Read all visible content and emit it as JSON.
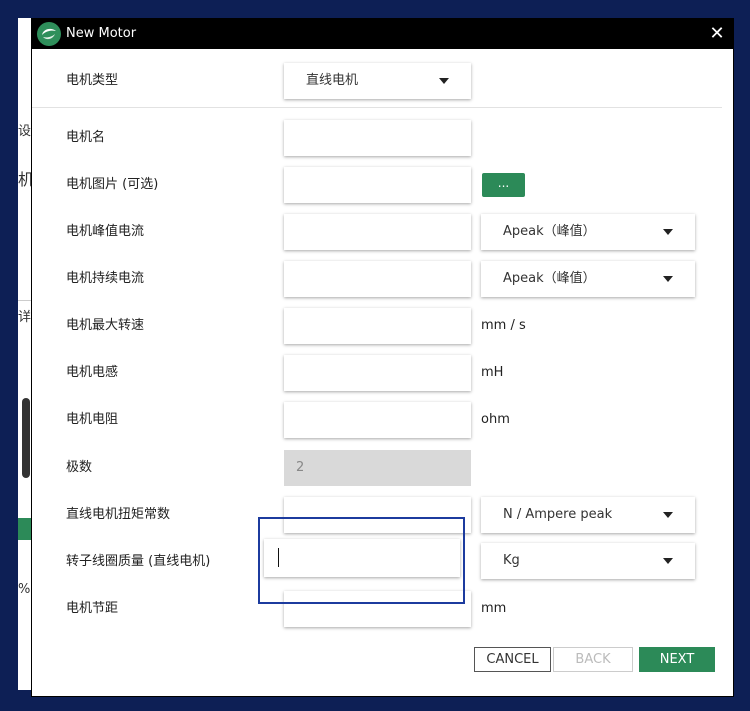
{
  "window": {
    "title": "New Motor",
    "close_glyph": "✕"
  },
  "background_fragments": [
    "设",
    "机",
    "详",
    "%"
  ],
  "rows": [
    {
      "label": "电机类型"
    },
    {
      "label": "电机名"
    },
    {
      "label": "电机图片 (可选)"
    },
    {
      "label": "电机峰值电流"
    },
    {
      "label": "电机持续电流"
    },
    {
      "label": "电机最大转速"
    },
    {
      "label": "电机电感"
    },
    {
      "label": "电机电阻"
    },
    {
      "label": "极数"
    },
    {
      "label": "直线电机扭矩常数"
    },
    {
      "label": "转子线圈质量 (直线电机)"
    },
    {
      "label": "电机节距"
    }
  ],
  "inputs": {
    "motor_type_selected": "直线电机",
    "motor_name": "",
    "motor_image": "",
    "peak_current": "",
    "continuous_current": "",
    "max_speed": "",
    "inductance": "",
    "resistance": "",
    "poles": "2",
    "torque_constant": "",
    "coil_mass": "",
    "pitch": ""
  },
  "browse_label": "...",
  "selects": {
    "peak_current_unit": "Apeak（峰值）",
    "continuous_current_unit": "Apeak（峰值）",
    "torque_constant_unit": "N / Ampere peak",
    "coil_mass_unit": "Kg"
  },
  "units": {
    "max_speed": "mm / s",
    "inductance": "mH",
    "resistance": "ohm",
    "pitch": "mm"
  },
  "buttons": {
    "cancel": "CANCEL",
    "back": "BACK",
    "next": "NEXT"
  },
  "colors": {
    "accent": "#2c8a58",
    "titlebar": "#000000",
    "highlight": "#1c3b9e"
  },
  "icons": {
    "app": "app-logo-icon",
    "close": "close-icon",
    "dropdown": "caret-down-icon"
  }
}
